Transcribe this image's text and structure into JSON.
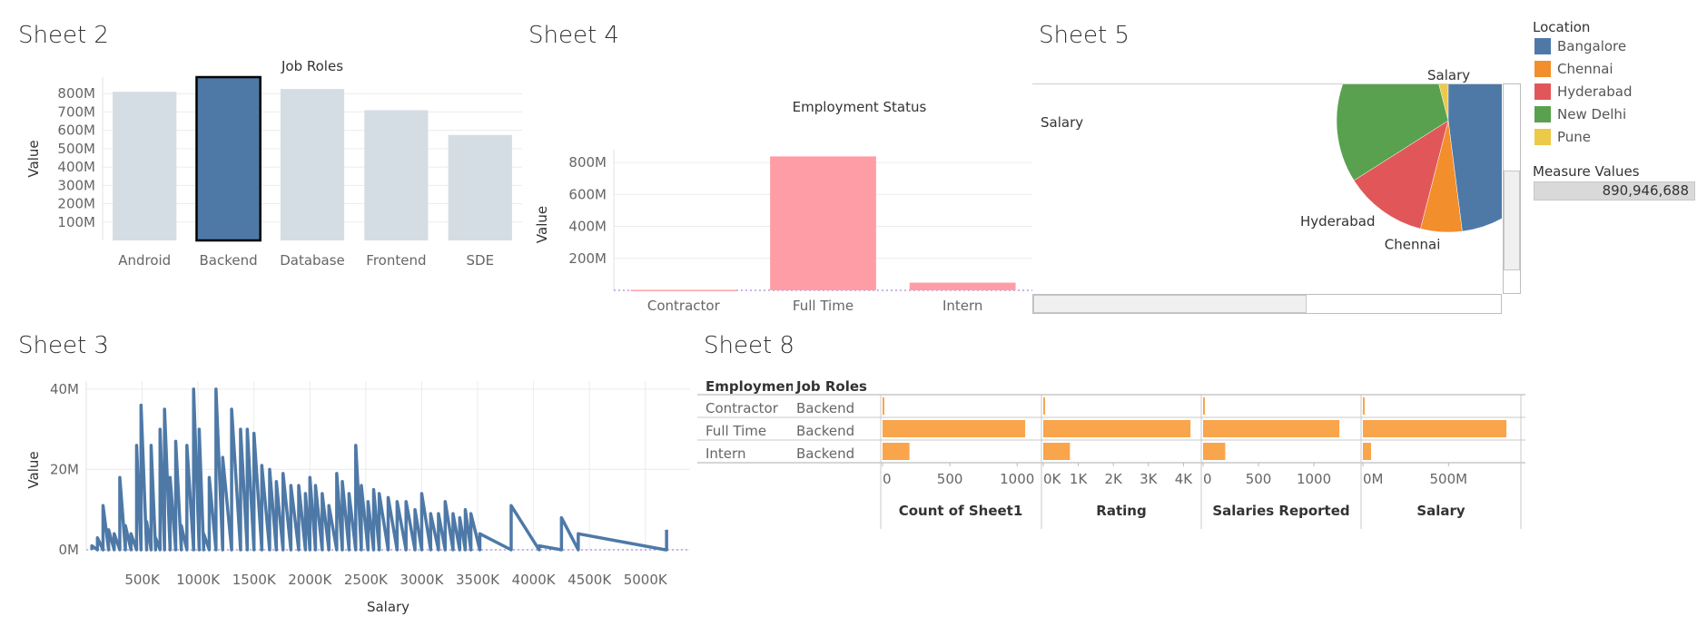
{
  "sheets": {
    "s2": "Sheet 2",
    "s4": "Sheet 4",
    "s5": "Sheet 5",
    "s3": "Sheet 3",
    "s8": "Sheet 8"
  },
  "colors": {
    "bar_selected": "#4e79a7",
    "bar_unselected": "#d5dde4",
    "employment_bar": "#ff9da7",
    "sheet8_bar": "#f9a54b",
    "line": "#4e79a7"
  },
  "location_legend": {
    "title": "Location",
    "items": [
      {
        "label": "Bangalore",
        "color": "#4e79a7"
      },
      {
        "label": "Chennai",
        "color": "#f28e2b"
      },
      {
        "label": "Hyderabad",
        "color": "#e15759"
      },
      {
        "label": "New Delhi",
        "color": "#59a14f"
      },
      {
        "label": "Pune",
        "color": "#edc948"
      }
    ]
  },
  "measure_legend": {
    "title": "Measure Values",
    "value": "890,946,688"
  },
  "chart_data": [
    {
      "id": "sheet2",
      "type": "bar",
      "title": "Job Roles",
      "xlabel": "",
      "ylabel": "Value",
      "categories": [
        "Android",
        "Backend",
        "Database",
        "Frontend",
        "SDE"
      ],
      "values": [
        810,
        890,
        825,
        710,
        575
      ],
      "selected": "Backend",
      "ylim": [
        0,
        890
      ],
      "yticks": [
        100,
        200,
        300,
        400,
        500,
        600,
        700,
        800
      ],
      "ytick_labels": [
        "100M",
        "200M",
        "300M",
        "400M",
        "500M",
        "600M",
        "700M",
        "800M"
      ],
      "unit": "M"
    },
    {
      "id": "sheet4",
      "type": "bar",
      "title": "Employment Status",
      "xlabel": "",
      "ylabel": "Value",
      "categories": [
        "Contractor",
        "Full Time",
        "Intern"
      ],
      "values": [
        3,
        838,
        48
      ],
      "ylim": [
        0,
        880
      ],
      "yticks": [
        200,
        400,
        600,
        800
      ],
      "ytick_labels": [
        "200M",
        "400M",
        "600M",
        "800M"
      ],
      "unit": "M"
    },
    {
      "id": "sheet5",
      "type": "pie",
      "title": "Salary",
      "side_label": "Salary",
      "slices": [
        {
          "label": "Bangalore",
          "value": 48
        },
        {
          "label": "Chennai",
          "value": 6
        },
        {
          "label": "Hyderabad",
          "value": 12
        },
        {
          "label": "New Delhi",
          "value": 30
        },
        {
          "label": "Pune",
          "value": 4
        }
      ],
      "visible_labels": [
        "Hyderabad",
        "Chennai"
      ]
    },
    {
      "id": "sheet3",
      "type": "line",
      "title": "",
      "xlabel": "Salary",
      "ylabel": "Value",
      "xlim": [
        0,
        5400
      ],
      "ylim": [
        0,
        42
      ],
      "xticks": [
        500,
        1000,
        1500,
        2000,
        2500,
        3000,
        3500,
        4000,
        4500,
        5000
      ],
      "xtick_labels": [
        "500K",
        "1000K",
        "1500K",
        "2000K",
        "2500K",
        "3000K",
        "3500K",
        "4000K",
        "4500K",
        "5000K"
      ],
      "yticks": [
        0,
        20,
        40
      ],
      "ytick_labels": [
        "0M",
        "20M",
        "40M"
      ],
      "spikes": [
        [
          50,
          1
        ],
        [
          100,
          3
        ],
        [
          150,
          11
        ],
        [
          200,
          5
        ],
        [
          250,
          4
        ],
        [
          300,
          18
        ],
        [
          350,
          6
        ],
        [
          400,
          4
        ],
        [
          450,
          26
        ],
        [
          490,
          36
        ],
        [
          540,
          7
        ],
        [
          580,
          26
        ],
        [
          620,
          3
        ],
        [
          660,
          30
        ],
        [
          700,
          35
        ],
        [
          750,
          18
        ],
        [
          800,
          27
        ],
        [
          850,
          6
        ],
        [
          900,
          26
        ],
        [
          960,
          40
        ],
        [
          1010,
          30
        ],
        [
          1050,
          4
        ],
        [
          1100,
          18
        ],
        [
          1160,
          40
        ],
        [
          1220,
          23
        ],
        [
          1300,
          35
        ],
        [
          1380,
          30
        ],
        [
          1440,
          30
        ],
        [
          1500,
          29
        ],
        [
          1570,
          21
        ],
        [
          1640,
          20
        ],
        [
          1700,
          17
        ],
        [
          1760,
          19
        ],
        [
          1830,
          16
        ],
        [
          1900,
          16
        ],
        [
          1960,
          14
        ],
        [
          2000,
          18
        ],
        [
          2050,
          16
        ],
        [
          2110,
          14
        ],
        [
          2170,
          11
        ],
        [
          2240,
          19
        ],
        [
          2290,
          17
        ],
        [
          2350,
          14
        ],
        [
          2410,
          26
        ],
        [
          2460,
          16
        ],
        [
          2520,
          12
        ],
        [
          2570,
          15
        ],
        [
          2620,
          14
        ],
        [
          2700,
          13
        ],
        [
          2780,
          12
        ],
        [
          2860,
          12
        ],
        [
          2940,
          10
        ],
        [
          3000,
          14
        ],
        [
          3080,
          9
        ],
        [
          3150,
          9
        ],
        [
          3210,
          12
        ],
        [
          3280,
          9
        ],
        [
          3340,
          8
        ],
        [
          3390,
          10
        ],
        [
          3440,
          9
        ],
        [
          3520,
          4
        ],
        [
          3800,
          11
        ],
        [
          4050,
          1
        ],
        [
          4250,
          8
        ],
        [
          4400,
          4
        ],
        [
          5180,
          0
        ],
        [
          5190,
          5
        ]
      ]
    },
    {
      "id": "sheet8",
      "type": "bar",
      "title": "",
      "row_headers": [
        "Employmen..",
        "Job Roles"
      ],
      "rows": [
        {
          "status": "Contractor",
          "role": "Backend"
        },
        {
          "status": "Full Time",
          "role": "Backend"
        },
        {
          "status": "Intern",
          "role": "Backend"
        }
      ],
      "panels": [
        {
          "label": "Count of Sheet1",
          "max": 1120,
          "values": [
            2,
            1060,
            200
          ],
          "ticks": [
            0,
            500,
            1000
          ],
          "tick_labels": [
            "0",
            "500",
            "1000"
          ]
        },
        {
          "label": "Rating",
          "max": 4300,
          "values": [
            25,
            4200,
            760
          ],
          "ticks": [
            0,
            1000,
            2000,
            3000,
            4000
          ],
          "tick_labels": [
            "0K",
            "1K",
            "2K",
            "3K",
            "4K"
          ]
        },
        {
          "label": "Salaries Reported",
          "max": 1360,
          "values": [
            2,
            1230,
            200
          ],
          "ticks": [
            0,
            500,
            1000
          ],
          "tick_labels": [
            "0",
            "500",
            "1000"
          ]
        },
        {
          "label": "Salary",
          "max": 880,
          "values": [
            3,
            838,
            48
          ],
          "ticks": [
            0,
            500
          ],
          "tick_labels": [
            "0M",
            "500M"
          ]
        }
      ]
    }
  ]
}
